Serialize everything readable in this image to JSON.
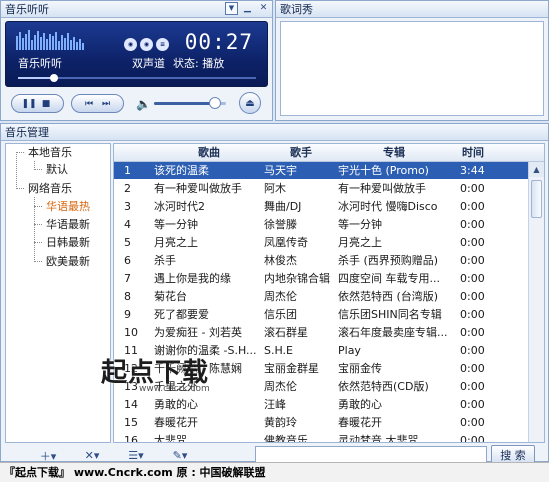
{
  "player": {
    "panel_title": "音乐听听",
    "time": "00:27",
    "song_label": "音乐听听",
    "channel": "双声道",
    "status_label": "状态:",
    "status_value": "播放",
    "progress": 0.15,
    "volume": 0.85
  },
  "lyrics": {
    "panel_title": "歌词秀"
  },
  "manager": {
    "panel_title": "音乐管理",
    "tree": {
      "local": "本地音乐",
      "default": "默认",
      "network": "网络音乐",
      "items": [
        "华语最热",
        "华语最新",
        "日韩最新",
        "欧美最新"
      ]
    },
    "columns": {
      "song": "歌曲",
      "artist": "歌手",
      "album": "专辑",
      "time": "时间"
    },
    "rows": [
      {
        "no": "1",
        "song": "该死的温柔",
        "artist": "马天宇",
        "album": "宇光十色 (Promo)",
        "time": "3:44"
      },
      {
        "no": "2",
        "song": "有一种爱叫做放手",
        "artist": "阿木",
        "album": "有一种爱叫做放手",
        "time": "0:00"
      },
      {
        "no": "3",
        "song": "冰河时代2",
        "artist": "舞曲/DJ",
        "album": "冰河时代 慢嗨Disco",
        "time": "0:00"
      },
      {
        "no": "4",
        "song": "等一分钟",
        "artist": "徐誉滕",
        "album": "等一分钟",
        "time": "0:00"
      },
      {
        "no": "5",
        "song": "月亮之上",
        "artist": "凤凰传奇",
        "album": "月亮之上",
        "time": "0:00"
      },
      {
        "no": "6",
        "song": "杀手",
        "artist": "林俊杰",
        "album": "杀手 (西界预购赠品)",
        "time": "0:00"
      },
      {
        "no": "7",
        "song": "遇上你是我的缘",
        "artist": "内地杂锦合辑",
        "album": "四度空间 车载专用...",
        "time": "0:00"
      },
      {
        "no": "8",
        "song": "菊花台",
        "artist": "周杰伦",
        "album": "依然范特西 (台湾版)",
        "time": "0:00"
      },
      {
        "no": "9",
        "song": "死了都要爱",
        "artist": "信乐团",
        "album": "信乐团SHIN同名专辑",
        "time": "0:00"
      },
      {
        "no": "10",
        "song": "为爱痴狂 - 刘若英",
        "artist": "滚石群星",
        "album": "滚石年度最卖座专辑...",
        "time": "0:00"
      },
      {
        "no": "11",
        "song": "谢谢你的温柔 -S.H...",
        "artist": "S.H.E",
        "album": "Play",
        "time": "0:00"
      },
      {
        "no": "12",
        "song": "千千阙歌 - 陈慧娴",
        "artist": "宝丽金群星",
        "album": "宝丽金传",
        "time": "0:00"
      },
      {
        "no": "13",
        "song": "千里之外",
        "artist": "周杰伦",
        "album": "依然范特西(CD版)",
        "time": "0:00"
      },
      {
        "no": "14",
        "song": "勇敢的心",
        "artist": "汪峰",
        "album": "勇敢的心",
        "time": "0:00"
      },
      {
        "no": "15",
        "song": "春暖花开",
        "artist": "黄韵玲",
        "album": "春暖花开",
        "time": "0:00"
      },
      {
        "no": "16",
        "song": "大悲咒",
        "artist": "佛教音乐",
        "album": "灵动梵音 大悲咒",
        "time": "0:00"
      }
    ]
  },
  "watermark": {
    "text": "起点下载",
    "url": "www.cncrk.com"
  },
  "search": {
    "placeholder": "",
    "button": "搜 索"
  },
  "footer": {
    "text": "『起点下载』 www.Cncrk.com 原 : 中国破解联盟"
  },
  "icons": {
    "menu": "menu-icon",
    "minimize": "minimize-icon",
    "close": "close-icon",
    "pause": "pause-icon",
    "stop": "stop-icon",
    "prev": "prev-icon",
    "next": "next-icon",
    "volume": "volume-icon",
    "eject": "eject-icon"
  },
  "colors": {
    "selected_row": "#2c5fb3",
    "active_tree_item": "#d8650c",
    "screen": "#0d2268"
  }
}
